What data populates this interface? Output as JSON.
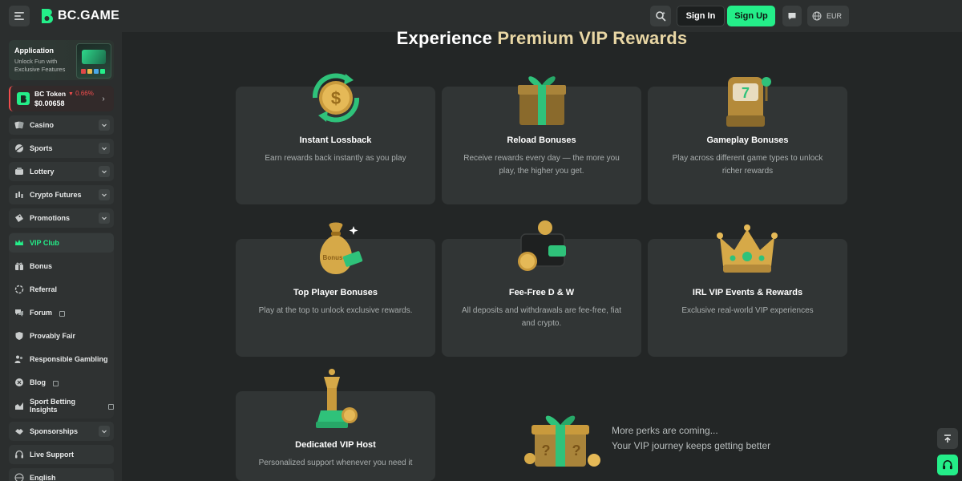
{
  "header": {
    "logo_text": "BC.GAME",
    "signin_label": "Sign In",
    "signup_label": "Sign Up",
    "currency": "EUR",
    "accent_color": "#24ee89"
  },
  "sidebar": {
    "app_card": {
      "title": "Application",
      "subtitle": "Unlock Fun with Exclusive Features"
    },
    "token": {
      "name": "BC Token",
      "change": "0.66%",
      "price": "$0.00658"
    },
    "groups": [
      {
        "label": "Casino",
        "icon": "casino-icon"
      },
      {
        "label": "Sports",
        "icon": "sports-icon"
      },
      {
        "label": "Lottery",
        "icon": "lottery-icon"
      },
      {
        "label": "Crypto Futures",
        "icon": "futures-icon"
      },
      {
        "label": "Promotions",
        "icon": "promotions-icon"
      }
    ],
    "links": [
      {
        "label": "VIP Club",
        "icon": "crown-icon",
        "active": true
      },
      {
        "label": "Bonus",
        "icon": "gift-icon"
      },
      {
        "label": "Referral",
        "icon": "referral-icon"
      },
      {
        "label": "Forum",
        "icon": "forum-icon",
        "external": true
      },
      {
        "label": "Provably Fair",
        "icon": "shield-icon"
      },
      {
        "label": "Responsible Gambling",
        "icon": "people-icon"
      },
      {
        "label": "Blog",
        "icon": "blog-icon",
        "external": true
      },
      {
        "label": "Sport Betting Insights",
        "icon": "insights-icon",
        "external": true
      }
    ],
    "bottom": [
      {
        "label": "Sponsorships",
        "icon": "handshake-icon"
      },
      {
        "label": "Live Support",
        "icon": "headset-icon"
      },
      {
        "label": "English",
        "icon": "globe-icon"
      }
    ]
  },
  "main": {
    "title_plain": "Experience",
    "title_accent": "Premium VIP Rewards",
    "cards": [
      {
        "title": "Instant Lossback",
        "desc": "Earn rewards back instantly as you play",
        "icon": "coin-arrows-icon"
      },
      {
        "title": "Reload Bonuses",
        "desc": "Receive rewards every day — the more you play, the higher you get.",
        "icon": "gift-box-icon"
      },
      {
        "title": "Gameplay Bonuses",
        "desc": "Play across different game types to unlock richer rewards",
        "icon": "slot-machine-icon"
      },
      {
        "title": "Top Player Bonuses",
        "desc": "Play at the top to unlock exclusive rewards.",
        "icon": "money-bag-icon",
        "badge": "Bonus"
      },
      {
        "title": "Fee-Free D & W",
        "desc": "All deposits and withdrawals are fee-free, fiat and crypto.",
        "icon": "wallet-icon"
      },
      {
        "title": "IRL VIP Events & Rewards",
        "desc": "Exclusive real-world VIP experiences",
        "icon": "crown-gold-icon"
      },
      {
        "title": "Dedicated VIP Host",
        "desc": "Personalized support whenever you need it",
        "icon": "chess-queen-icon"
      }
    ],
    "perks_line1": "More perks are coming...",
    "perks_line2": "Your VIP journey keeps getting better"
  }
}
